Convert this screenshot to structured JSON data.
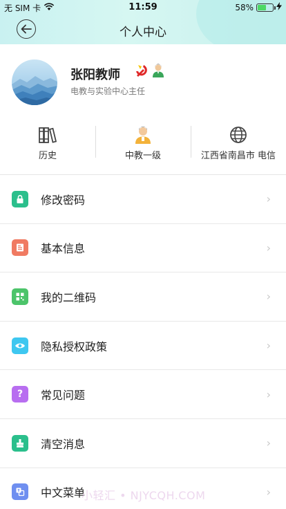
{
  "status_bar": {
    "carrier": "无 SIM 卡",
    "time": "11:59",
    "battery": "58%",
    "battery_level": 0.58
  },
  "header": {
    "title": "个人中心"
  },
  "profile": {
    "name": "张阳教师",
    "role": "电教与实验中心主任"
  },
  "stats": [
    {
      "icon": "books-icon",
      "label": "历史"
    },
    {
      "icon": "teacher-icon",
      "label": "中教一级"
    },
    {
      "icon": "globe-icon",
      "label": "江西省南昌市 电信"
    }
  ],
  "menu": [
    {
      "icon": "lock-icon",
      "label": "修改密码",
      "color": "#2bbf8c"
    },
    {
      "icon": "info-doc-icon",
      "label": "基本信息",
      "color": "#f07a62"
    },
    {
      "icon": "qr-code-icon",
      "label": "我的二维码",
      "color": "#4cc46a"
    },
    {
      "icon": "eye-icon",
      "label": "隐私授权政策",
      "color": "#3ec7f0"
    },
    {
      "icon": "question-icon",
      "label": "常见问题",
      "color": "#b86ef0",
      "glyph": "?"
    },
    {
      "icon": "broom-icon",
      "label": "清空消息",
      "color": "#2bbf8c"
    },
    {
      "icon": "translate-icon",
      "label": "中文菜单",
      "color": "#6f8ff0"
    }
  ],
  "watermark": "小轻汇 • NJYCQH.COM"
}
